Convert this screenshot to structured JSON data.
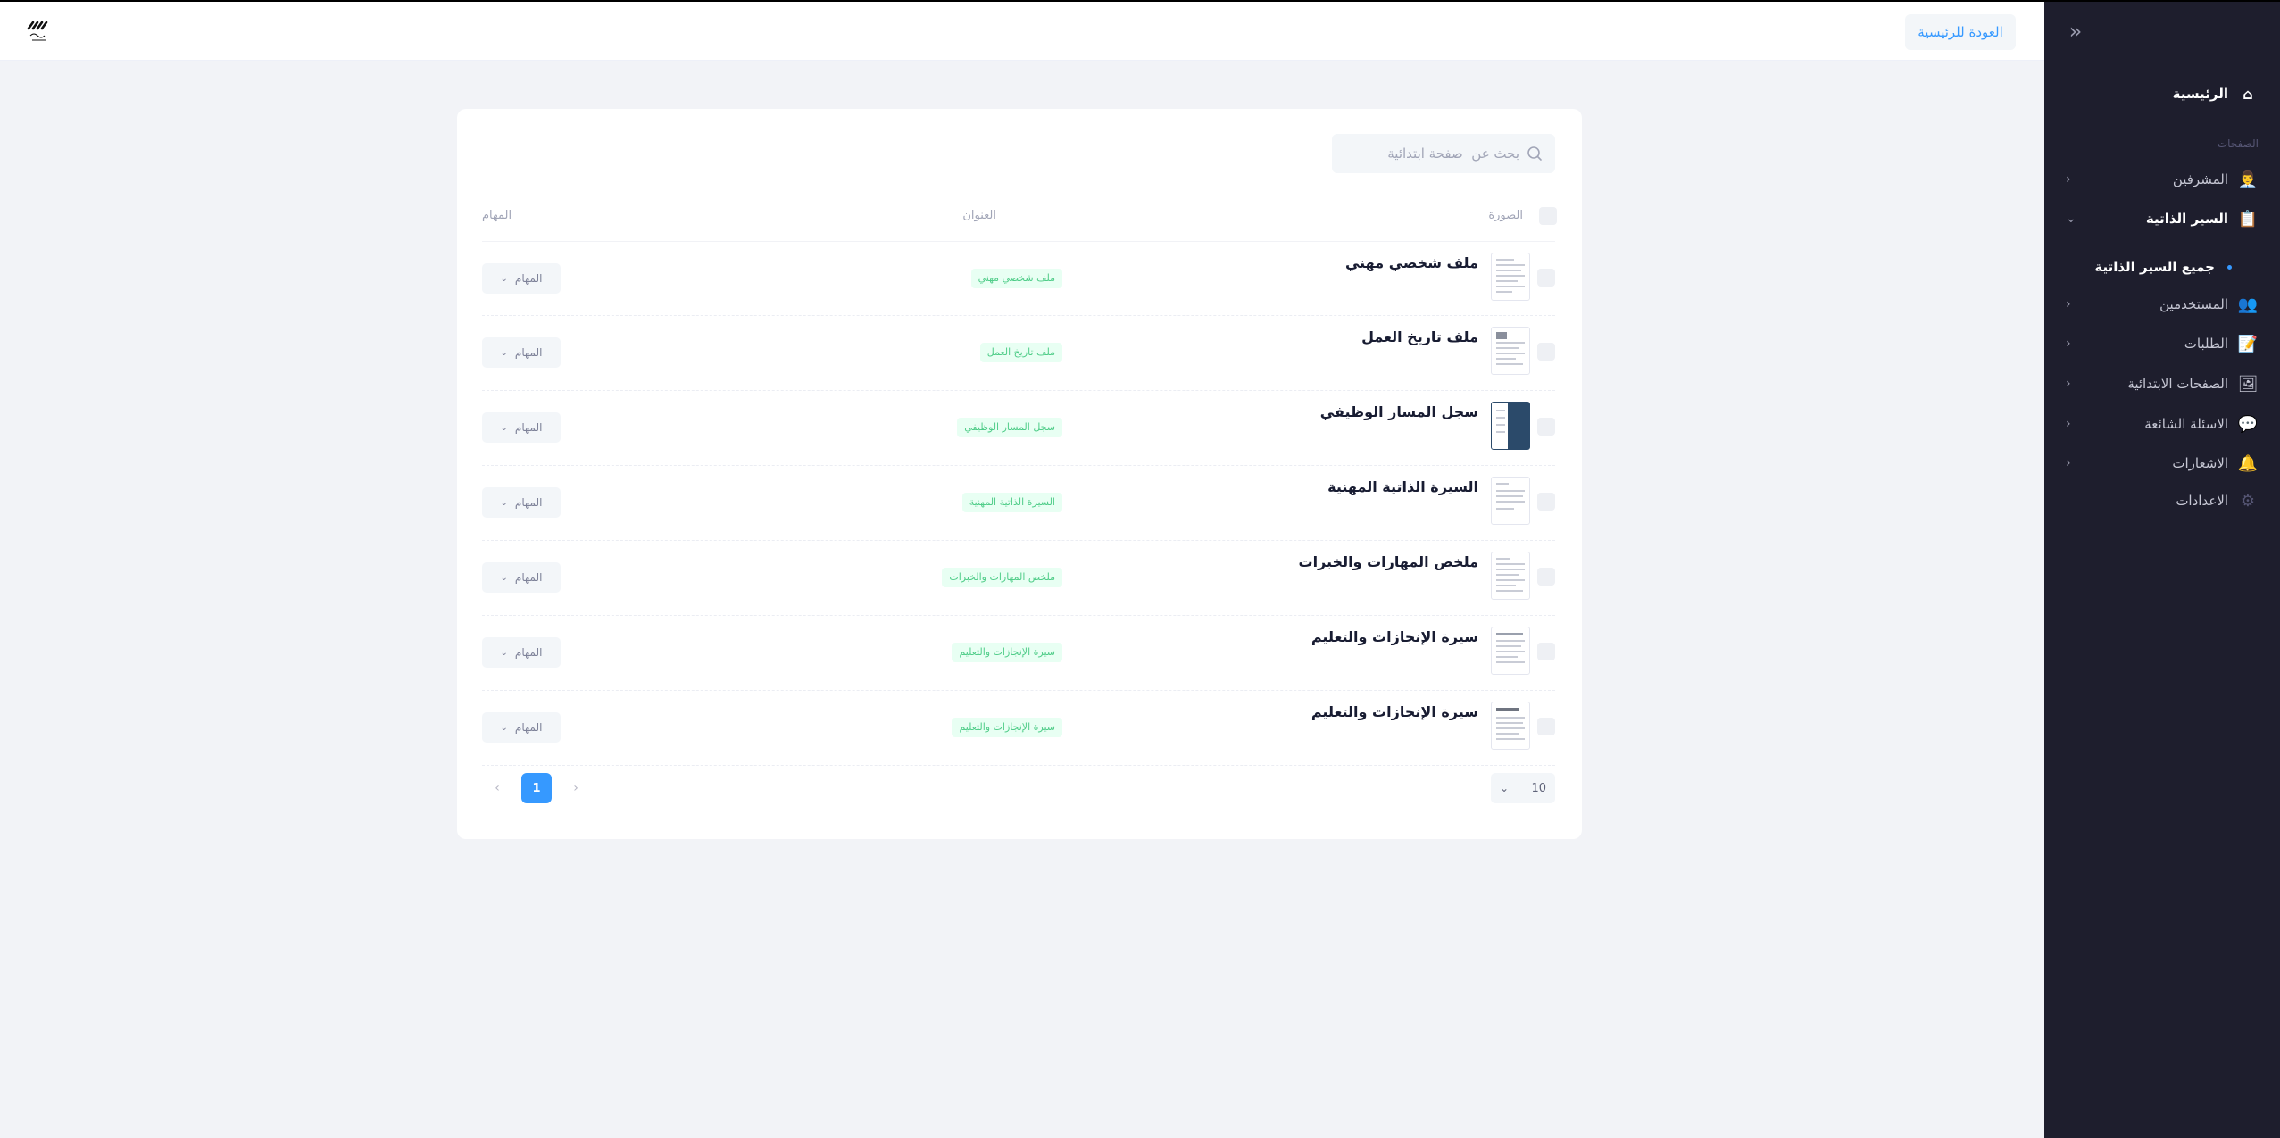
{
  "header": {
    "back_label": "العودة للرئيسية"
  },
  "sidebar": {
    "home": "الرئيسية",
    "section_label": "الصفحات",
    "items": [
      {
        "label": "المشرفين",
        "icon": "supervisor-icon"
      },
      {
        "label": "السير الذاتية",
        "icon": "cv-icon"
      },
      {
        "label": "المستخدمين",
        "icon": "users-icon"
      },
      {
        "label": "الطلبات",
        "icon": "orders-icon"
      },
      {
        "label": "الصفحات الابتدائية",
        "icon": "landing-pages-icon"
      },
      {
        "label": "الاسئلة الشائعة",
        "icon": "faq-icon"
      },
      {
        "label": "الاشعارات",
        "icon": "bell-icon"
      },
      {
        "label": "الاعدادات",
        "icon": "gear-icon"
      }
    ],
    "sub_item": "جميع السير الذاتية"
  },
  "search": {
    "placeholder": "بحث عن  صفحة ابتدائية"
  },
  "table": {
    "headers": {
      "image": "الصورة",
      "title": "العنوان",
      "tasks": "المهام"
    },
    "rows": [
      {
        "title": "ملف شخصي مهني",
        "badge": "ملف شخصي مهني",
        "tasks": "المهام"
      },
      {
        "title": "ملف تاريخ العمل",
        "badge": "ملف تاريخ العمل",
        "tasks": "المهام"
      },
      {
        "title": "سجل المسار الوظيفي",
        "badge": "سجل المسار الوظيفي",
        "tasks": "المهام"
      },
      {
        "title": "السيرة الذاتية المهنية",
        "badge": "السيرة الذاتية المهنية",
        "tasks": "المهام"
      },
      {
        "title": "ملخص المهارات والخبرات",
        "badge": "ملخص المهارات والخبرات",
        "tasks": "المهام"
      },
      {
        "title": "سيرة الإنجازات والتعليم",
        "badge": "سيرة الإنجازات والتعليم",
        "tasks": "المهام"
      },
      {
        "title": "سيرة الإنجازات والتعليم",
        "badge": "سيرة الإنجازات والتعليم",
        "tasks": "المهام"
      }
    ]
  },
  "pagination": {
    "page_size": "10",
    "current_page": "1"
  },
  "colors": {
    "accent": "#3699ff",
    "sidebar_bg": "#1e1e2d",
    "badge_text": "#50cd89",
    "badge_bg": "#e8fff3"
  }
}
